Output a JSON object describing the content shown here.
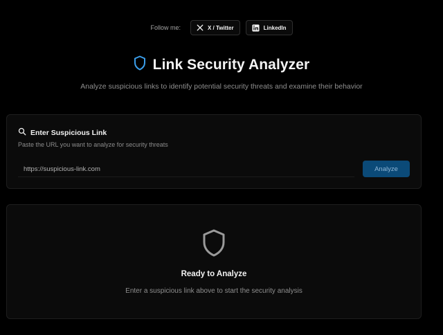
{
  "follow": {
    "label": "Follow me:",
    "twitter_label": "X / Twitter",
    "linkedin_label": "LinkedIn"
  },
  "header": {
    "title": "Link Security Analyzer",
    "subtitle": "Analyze suspicious links to identify potential security threats and examine their behavior",
    "accent_color": "#3b9eea"
  },
  "input_card": {
    "title": "Enter Suspicious Link",
    "description": "Paste the URL you want to analyze for security threats",
    "url_placeholder": "https://suspicious-link.com",
    "url_value": "",
    "analyze_label": "Analyze",
    "analyze_color": "#0b4a78"
  },
  "empty_state": {
    "icon": "shield-icon",
    "title": "Ready to Analyze",
    "description": "Enter a suspicious link above to start the security analysis"
  }
}
